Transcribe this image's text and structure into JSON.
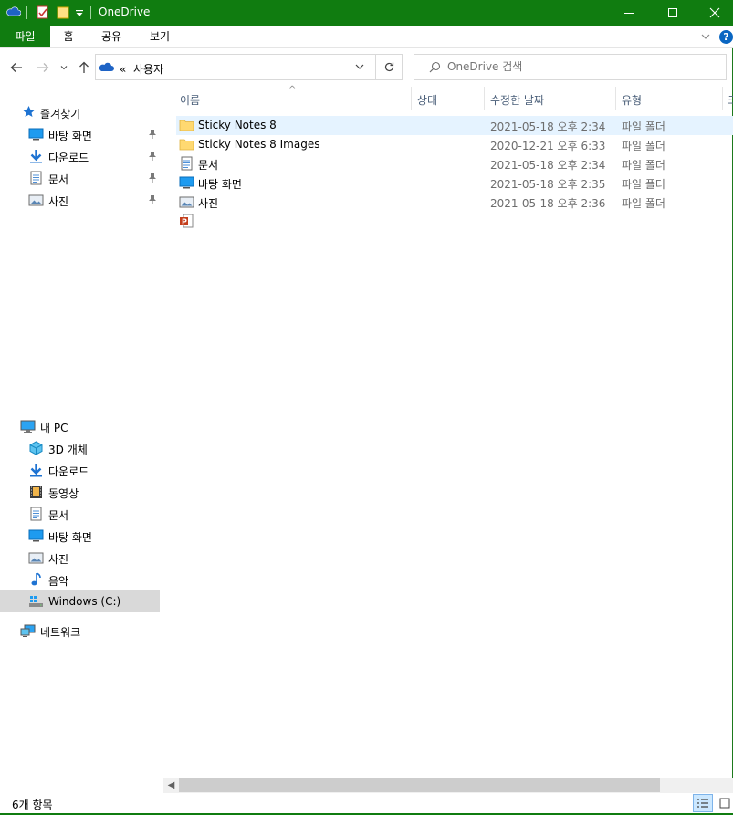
{
  "window": {
    "title": "OneDrive",
    "colors": {
      "titlebar": "#107c10",
      "selection": "#e5f3ff",
      "nav_selected": "#d9d9d9"
    }
  },
  "ribbon": {
    "tabs": [
      "파일",
      "홈",
      "공유",
      "보기"
    ],
    "help_label": "?"
  },
  "address": {
    "path_prefix": "«",
    "path": "사용자"
  },
  "search": {
    "placeholder": "OneDrive 검색"
  },
  "nav": {
    "quick_access": {
      "label": "즐겨찾기",
      "items": [
        {
          "label": "바탕 화면",
          "icon": "desktop-icon",
          "pinned": true
        },
        {
          "label": "다운로드",
          "icon": "download-icon",
          "pinned": true
        },
        {
          "label": "문서",
          "icon": "document-icon",
          "pinned": true
        },
        {
          "label": "사진",
          "icon": "pictures-icon",
          "pinned": true
        }
      ]
    },
    "this_pc": {
      "label": "내 PC",
      "items": [
        {
          "label": "3D 개체",
          "icon": "3d-objects-icon"
        },
        {
          "label": "다운로드",
          "icon": "download-icon"
        },
        {
          "label": "동영상",
          "icon": "video-icon"
        },
        {
          "label": "문서",
          "icon": "document-icon"
        },
        {
          "label": "바탕 화면",
          "icon": "desktop-icon"
        },
        {
          "label": "사진",
          "icon": "pictures-icon"
        },
        {
          "label": "음악",
          "icon": "music-icon"
        },
        {
          "label": "Windows  (C:)",
          "icon": "drive-icon",
          "selected": true
        }
      ]
    },
    "network": {
      "label": "네트워크",
      "icon": "network-icon"
    }
  },
  "columns": {
    "name": "이름",
    "status": "상태",
    "modified": "수정한 날짜",
    "type": "유형",
    "size": "크"
  },
  "files": [
    {
      "name": "Sticky Notes 8",
      "icon": "folder-icon",
      "date": "2021-05-18 오후 2:34",
      "type": "파일 폴더",
      "selected": true
    },
    {
      "name": "Sticky Notes 8 Images",
      "icon": "folder-icon",
      "date": "2020-12-21 오후 6:33",
      "type": "파일 폴더"
    },
    {
      "name": "문서",
      "icon": "document-icon",
      "date": "2021-05-18 오후 2:34",
      "type": "파일 폴더"
    },
    {
      "name": "바탕 화면",
      "icon": "desktop-icon",
      "date": "2021-05-18 오후 2:35",
      "type": "파일 폴더"
    },
    {
      "name": "사진",
      "icon": "pictures-icon",
      "date": "2021-05-18 오후 2:36",
      "type": "파일 폴더"
    },
    {
      "name": "",
      "icon": "powerpoint-icon",
      "date": "",
      "type": ""
    }
  ],
  "status": {
    "item_count": "6개 항목"
  }
}
